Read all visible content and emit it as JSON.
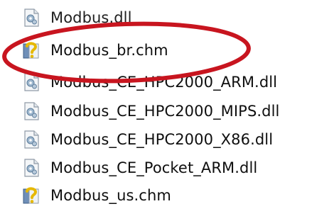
{
  "files": [
    {
      "name": "Modbus.dll",
      "icon": "dll-file-icon"
    },
    {
      "name": "Modbus_br.chm",
      "icon": "chm-help-file-icon"
    },
    {
      "name": "Modbus_CE_HPC2000_ARM.dll",
      "icon": "dll-file-icon"
    },
    {
      "name": "Modbus_CE_HPC2000_MIPS.dll",
      "icon": "dll-file-icon"
    },
    {
      "name": "Modbus_CE_HPC2000_X86.dll",
      "icon": "dll-file-icon"
    },
    {
      "name": "Modbus_CE_Pocket_ARM.dll",
      "icon": "dll-file-icon"
    },
    {
      "name": "Modbus_us.chm",
      "icon": "chm-help-file-icon"
    }
  ],
  "colors": {
    "highlight": "#c8151f",
    "text": "#0f0f0f",
    "background": "#ffffff"
  }
}
